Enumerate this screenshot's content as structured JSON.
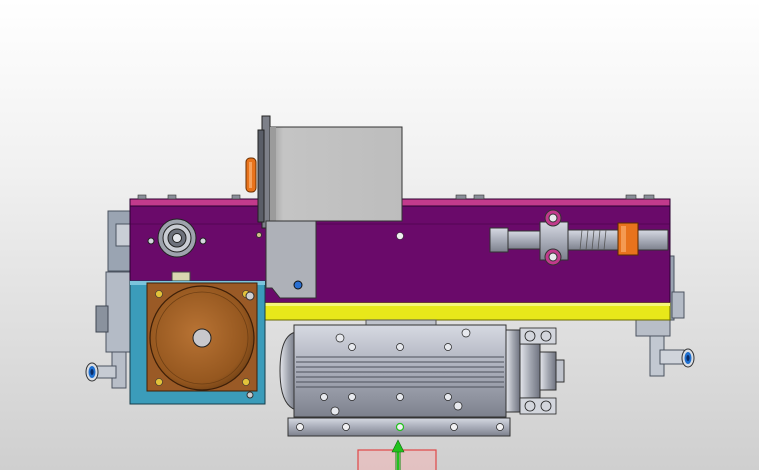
{
  "viewport": {
    "background_top": "#ffffff",
    "background_bottom": "#cfcfcf"
  },
  "model": {
    "components": [
      "main-frame",
      "gray-mount-plate",
      "motor-housing",
      "spindle-motor",
      "round-cover",
      "linear-actuator",
      "orange-block",
      "bearing-assembly",
      "side-fittings",
      "yellow-rail",
      "origin-triad"
    ],
    "colors": {
      "frame_purple": "#6a0a6a",
      "frame_top_pink": "#c23a8c",
      "rail_yellow": "#e8e81a",
      "housing_teal": "#3b9cba",
      "cover_brown": "#9a5a26",
      "steel_gray": "#a8acb8",
      "plate_gray": "#c0c0c0",
      "orange_block": "#e8731c",
      "fitting_blue": "#1e6fd0",
      "axis_green": "#21c21c",
      "axis_red": "#e04848"
    }
  }
}
